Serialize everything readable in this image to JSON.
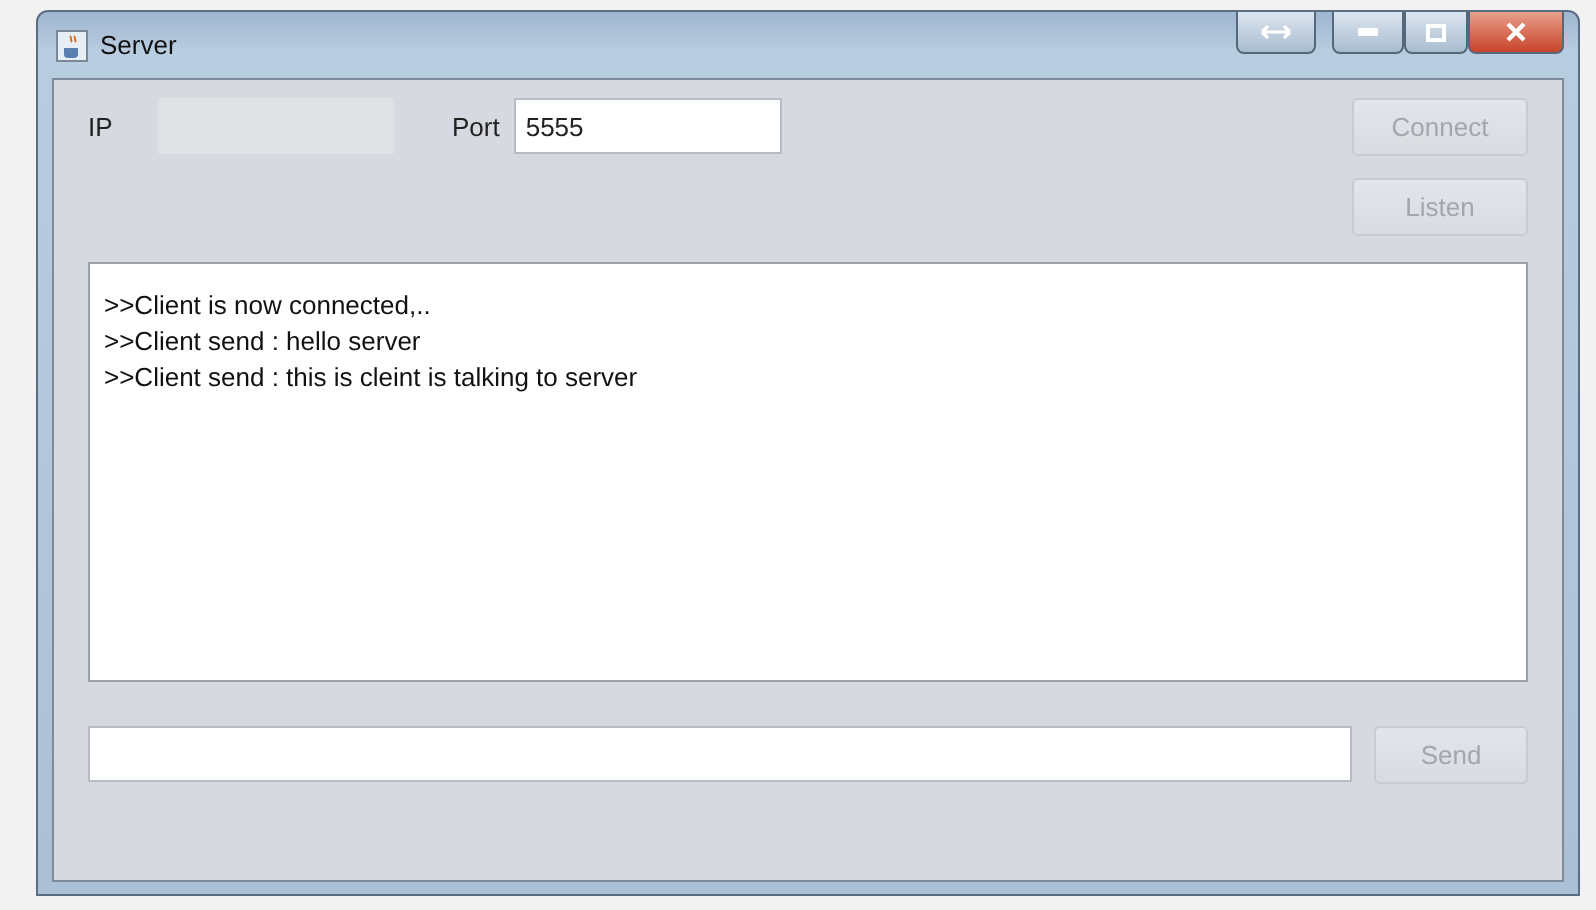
{
  "window": {
    "title": "Server"
  },
  "connection": {
    "ip_label": "IP",
    "ip_field": {
      "disabled": true
    },
    "port_label": "Port",
    "port_field": {
      "value": "5555",
      "disabled": false
    }
  },
  "buttons": [
    {
      "label": "Connect",
      "disabled": true
    },
    {
      "label": "Listen",
      "disabled": true
    }
  ],
  "log": [
    ">>Client is now connected,..",
    ">>Client send : hello server",
    ">>Client send : this is cleint is talking to server"
  ],
  "message_field": {
    "disabled": false
  },
  "send_button": {
    "label": "Send",
    "disabled": true
  }
}
